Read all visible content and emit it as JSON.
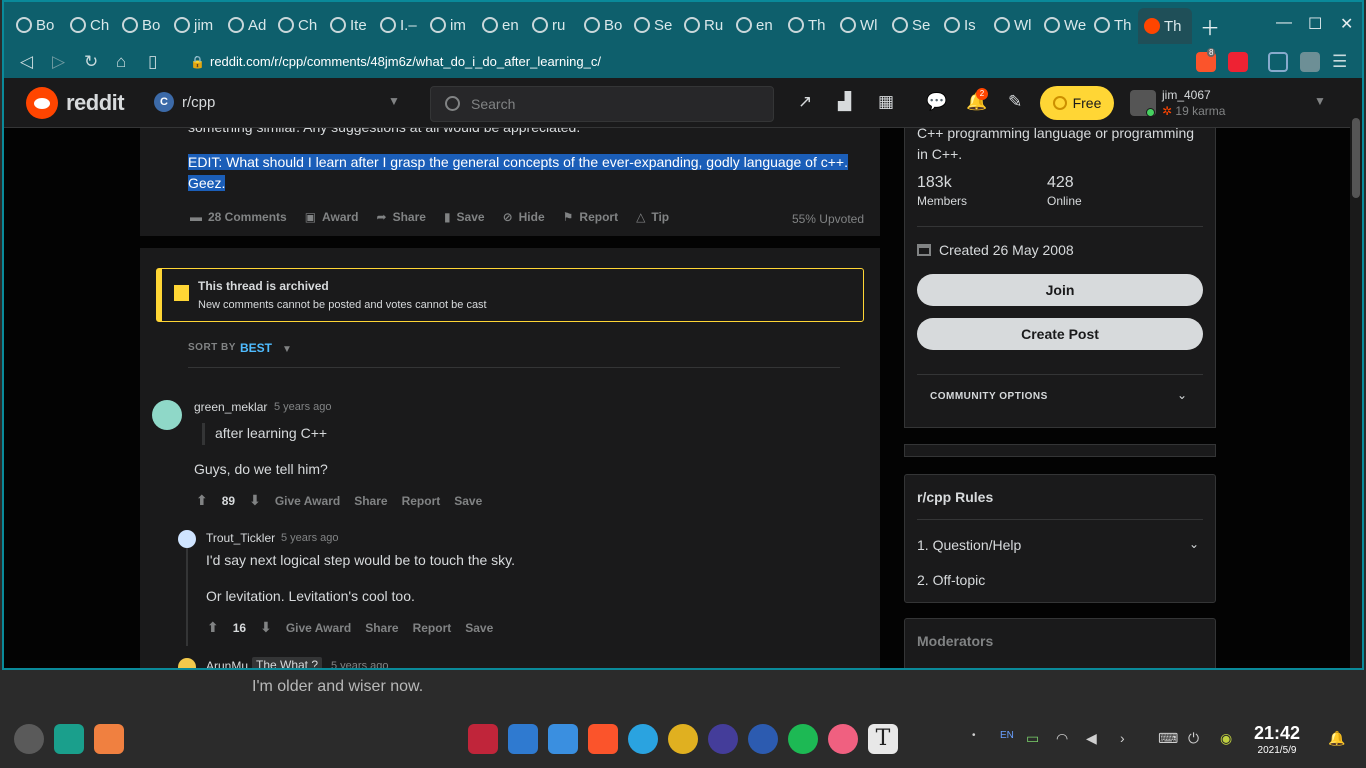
{
  "browser": {
    "tabs": [
      "Bo",
      "Ch",
      "Bo",
      "jim",
      "Ad",
      "Ch",
      "Ite",
      "I.–",
      "im",
      "en",
      "ru",
      "Bo",
      "Se",
      "Ru",
      "en",
      "Th",
      "Wl",
      "Se",
      "Is",
      "Wl",
      "We",
      "Th",
      "Th"
    ],
    "url": "reddit.com/r/cpp/comments/48jm6z/what_do_i_do_after_learning_c/",
    "brave_badge": "8"
  },
  "reddit": {
    "wordmark": "reddit",
    "subreddit": "r/cpp",
    "subreddit_icon": "C",
    "search_placeholder": "Search",
    "notif_count": "2",
    "free_label": "Free",
    "username": "jim_4067",
    "karma": "19 karma"
  },
  "post": {
    "cut_text": "something similar. Any suggestions at all would be appreciated.",
    "edit_text": "EDIT: What should I learn after I grasp the general concepts of the ever-expanding, godly language of c++. Geez.",
    "actions": [
      "28 Comments",
      "Award",
      "Share",
      "Save",
      "Hide",
      "Report",
      "Tip"
    ],
    "upvoted": "55% Upvoted"
  },
  "archive": {
    "title": "This thread is archived",
    "subtitle": "New comments cannot be posted and votes cannot be cast"
  },
  "sort": {
    "label": "SORT BY",
    "value": "BEST"
  },
  "comments": [
    {
      "author": "green_meklar",
      "time": "5 years ago",
      "quote": "after learning C++",
      "body": "Guys, do we tell him?",
      "votes": "89",
      "actions": [
        "Give Award",
        "Share",
        "Report",
        "Save"
      ]
    },
    {
      "author": "Trout_Tickler",
      "time": "5 years ago",
      "body1": "I'd say next logical step would be to touch the sky.",
      "body2": "Or levitation. Levitation's cool too.",
      "votes": "16",
      "actions": [
        "Give Award",
        "Share",
        "Report",
        "Save"
      ]
    },
    {
      "author": "ArunMu",
      "flair": "The What ?",
      "time": "5 years ago"
    }
  ],
  "sidebar": {
    "desc": "C++ programming language or programming in C++.",
    "members_num": "183k",
    "members_label": "Members",
    "online_num": "428",
    "online_label": "Online",
    "created": "Created 26 May 2008",
    "join": "Join",
    "create_post": "Create Post",
    "community_options": "COMMUNITY OPTIONS",
    "rules_title": "r/cpp Rules",
    "rules": [
      "1. Question/Help",
      "2. Off-topic"
    ],
    "moderators": "Moderators"
  },
  "desktop": {
    "tooltip": "I'm older and wiser now.",
    "time": "21:42",
    "date": "2021/5/9",
    "kb": "EN"
  }
}
